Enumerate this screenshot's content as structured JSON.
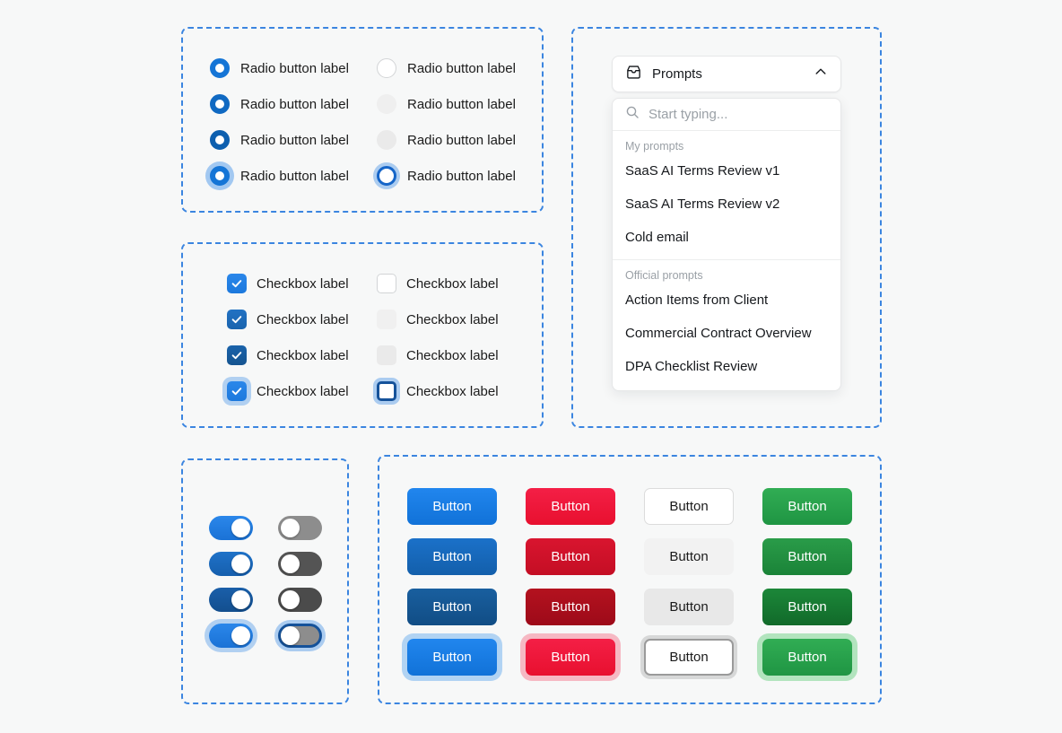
{
  "theme": {
    "page_background": "#f7f8f8",
    "spec_border_color": "#3b85e0",
    "accent_blue": "#1172d8",
    "accent_red": "#e8102f",
    "accent_green": "#1f9543",
    "accent_gray": "#8d8d8d",
    "focus_ring": "#78afeb"
  },
  "radio_group": {
    "checked_column": [
      {
        "label": "Radio button label",
        "state": "default"
      },
      {
        "label": "Radio button label",
        "state": "hover"
      },
      {
        "label": "Radio button label",
        "state": "active"
      },
      {
        "label": "Radio button label",
        "state": "focus"
      }
    ],
    "unchecked_column": [
      {
        "label": "Radio button label",
        "state": "default"
      },
      {
        "label": "Radio button label",
        "state": "hover"
      },
      {
        "label": "Radio button label",
        "state": "active"
      },
      {
        "label": "Radio button label",
        "state": "focus"
      }
    ]
  },
  "checkbox_group": {
    "checked_column": [
      {
        "label": "Checkbox label",
        "state": "default"
      },
      {
        "label": "Checkbox label",
        "state": "hover"
      },
      {
        "label": "Checkbox label",
        "state": "active"
      },
      {
        "label": "Checkbox label",
        "state": "focus"
      }
    ],
    "unchecked_column": [
      {
        "label": "Checkbox label",
        "state": "default"
      },
      {
        "label": "Checkbox label",
        "state": "hover"
      },
      {
        "label": "Checkbox label",
        "state": "active"
      },
      {
        "label": "Checkbox label",
        "state": "focus"
      }
    ]
  },
  "toggle_group": {
    "on_column": [
      {
        "state": "default",
        "value": "on"
      },
      {
        "state": "hover",
        "value": "on"
      },
      {
        "state": "active",
        "value": "on"
      },
      {
        "state": "focus",
        "value": "on"
      }
    ],
    "off_column": [
      {
        "state": "default",
        "value": "off"
      },
      {
        "state": "hover",
        "value": "off"
      },
      {
        "state": "active",
        "value": "off"
      },
      {
        "state": "focus",
        "value": "off"
      }
    ]
  },
  "buttons": {
    "columns": [
      {
        "variant": "primary-blue",
        "items": [
          {
            "label": "Button",
            "state": "default"
          },
          {
            "label": "Button",
            "state": "hover"
          },
          {
            "label": "Button",
            "state": "active"
          },
          {
            "label": "Button",
            "state": "focus"
          }
        ]
      },
      {
        "variant": "danger-red",
        "items": [
          {
            "label": "Button",
            "state": "default"
          },
          {
            "label": "Button",
            "state": "hover"
          },
          {
            "label": "Button",
            "state": "active"
          },
          {
            "label": "Button",
            "state": "focus"
          }
        ]
      },
      {
        "variant": "secondary-white",
        "items": [
          {
            "label": "Button",
            "state": "default"
          },
          {
            "label": "Button",
            "state": "hover"
          },
          {
            "label": "Button",
            "state": "active"
          },
          {
            "label": "Button",
            "state": "focus"
          }
        ]
      },
      {
        "variant": "success-green",
        "items": [
          {
            "label": "Button",
            "state": "default"
          },
          {
            "label": "Button",
            "state": "hover"
          },
          {
            "label": "Button",
            "state": "active"
          },
          {
            "label": "Button",
            "state": "focus"
          }
        ]
      }
    ]
  },
  "prompts": {
    "header": {
      "title": "Prompts",
      "icon": "inbox-tray-icon",
      "chevron": "chevron-up-icon",
      "expanded": true
    },
    "search": {
      "icon": "search-icon",
      "placeholder": "Start typing...",
      "value": ""
    },
    "groups": [
      {
        "label": "My prompts",
        "items": [
          "SaaS AI Terms Review v1",
          "SaaS AI Terms Review v2",
          "Cold email"
        ]
      },
      {
        "label": "Official prompts",
        "items": [
          "Action Items from Client",
          "Commercial Contract Overview",
          "DPA Checklist Review"
        ]
      }
    ]
  }
}
